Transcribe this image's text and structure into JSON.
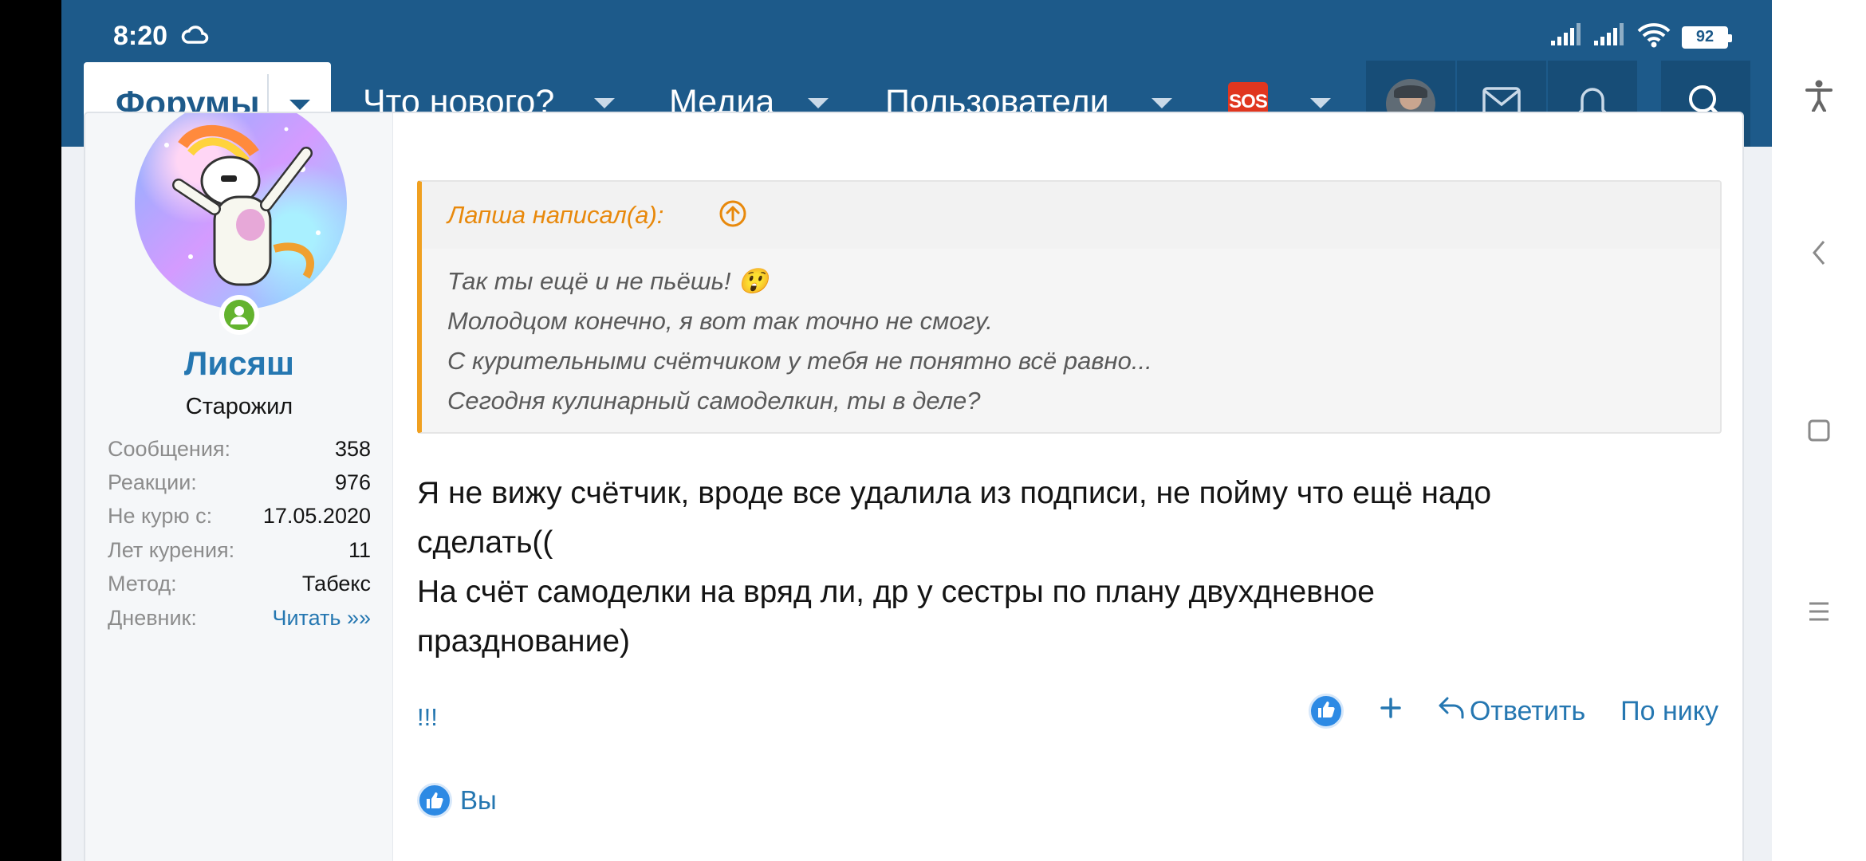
{
  "status_bar": {
    "time": "8:20",
    "battery": "92"
  },
  "header": {
    "tabs": [
      {
        "label": "Форумы"
      },
      {
        "label": "Что нового?"
      },
      {
        "label": "Медиа"
      },
      {
        "label": "Пользователи"
      }
    ],
    "sos_label": "SOS"
  },
  "user": {
    "name": "Лисяш",
    "title": "Старожил",
    "stats": [
      {
        "label": "Сообщения:",
        "value": "358"
      },
      {
        "label": "Реакции:",
        "value": "976"
      },
      {
        "label": "Не курю с:",
        "value": "17.05.2020"
      },
      {
        "label": "Лет курения:",
        "value": "11"
      },
      {
        "label": "Метод:",
        "value": "Табекс"
      },
      {
        "label": "Дневник:",
        "value": "Читать »»"
      }
    ]
  },
  "quote": {
    "author": "Лапша написал(а):",
    "lines": [
      "Так ты ещё и не пьёшь! 😲",
      "Молодцом конечно, я вот так точно не смогу.",
      "С курительными счётчиком у тебя не понятно всё равно...",
      "Сегодня кулинарный самоделкин, ты в деле?"
    ]
  },
  "message": {
    "lines": [
      "Я не вижу счётчик, вроде все удалила из подписи, не пойму что ещё надо",
      "сделать((",
      "На счёт самоделки на вряд ли, др у сестры по плану двухдневное",
      "празднование)"
    ]
  },
  "post_footer": {
    "left_link": "!!!",
    "reply": "Ответить",
    "by_nick": "По нику",
    "reactions_text": "Вы"
  },
  "colors": {
    "header_bg": "#1d5a8a",
    "link": "#2577b1",
    "quote_accent": "#f0a020",
    "online": "#63b32e",
    "sos": "#e0361f"
  }
}
